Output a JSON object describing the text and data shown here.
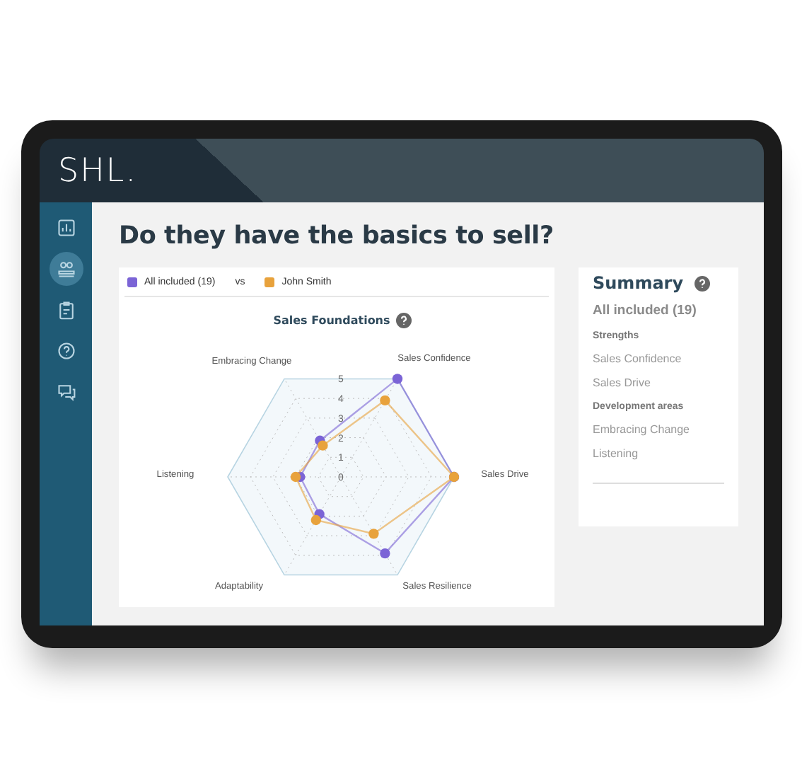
{
  "header": {
    "logo": "SHL."
  },
  "sidebar": {
    "items": [
      {
        "selected": false
      },
      {
        "selected": true
      },
      {
        "selected": false
      },
      {
        "selected": false
      },
      {
        "selected": false
      }
    ]
  },
  "title": "Do they have the basics to sell?",
  "chart_card": {
    "legend_separator": "vs",
    "radar_chart": {
      "title": "Sales Foundations",
      "axis_labels": [
        "Embracing Change",
        "Sales Confidence",
        "Listening",
        "Sales Drive",
        "Adaptability",
        "Sales Resilience"
      ],
      "tick_labels": [
        "5",
        "4",
        "3",
        "2",
        "1",
        "0"
      ],
      "series": [
        {
          "name": "All included (19)",
          "color": "#7b64d6"
        },
        {
          "name": "John Smith",
          "color": "#e8a23c"
        }
      ]
    }
  },
  "summary": {
    "title": "Summary",
    "group": "All included (19)",
    "sections": [
      {
        "heading": "Strengths",
        "items": [
          "Sales Confidence",
          "Sales Drive"
        ]
      },
      {
        "heading": "Development areas",
        "items": [
          "Embracing Change",
          "Listening"
        ]
      }
    ]
  }
}
